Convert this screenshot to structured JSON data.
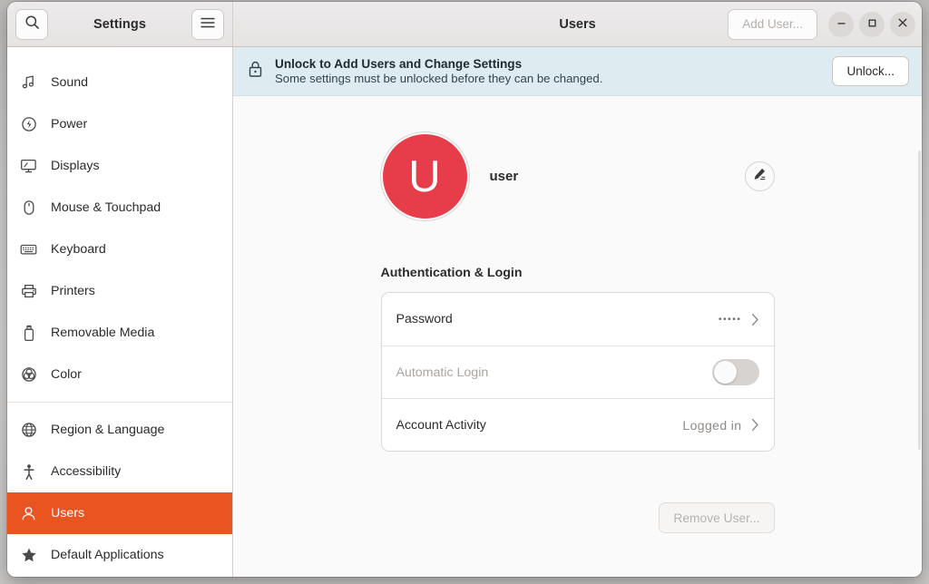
{
  "window": {
    "app_title": "Settings",
    "page_title": "Users"
  },
  "header": {
    "search_icon": "search-icon",
    "menu_icon": "hamburger-menu-icon",
    "add_user_label": "Add User...",
    "minimize_icon": "minimize-icon",
    "maximize_icon": "maximize-icon",
    "close_icon": "close-icon"
  },
  "sidebar": {
    "items": [
      {
        "label": "Sound",
        "icon": "music-note-icon",
        "selected": false,
        "sep_after": false
      },
      {
        "label": "Power",
        "icon": "power-bolt-icon",
        "selected": false,
        "sep_after": false
      },
      {
        "label": "Displays",
        "icon": "monitor-icon",
        "selected": false,
        "sep_after": false
      },
      {
        "label": "Mouse & Touchpad",
        "icon": "mouse-icon",
        "selected": false,
        "sep_after": false
      },
      {
        "label": "Keyboard",
        "icon": "keyboard-icon",
        "selected": false,
        "sep_after": false
      },
      {
        "label": "Printers",
        "icon": "printer-icon",
        "selected": false,
        "sep_after": false
      },
      {
        "label": "Removable Media",
        "icon": "usb-drive-icon",
        "selected": false,
        "sep_after": false
      },
      {
        "label": "Color",
        "icon": "color-wheel-icon",
        "selected": false,
        "sep_after": true
      },
      {
        "label": "Region & Language",
        "icon": "globe-icon",
        "selected": false,
        "sep_after": false
      },
      {
        "label": "Accessibility",
        "icon": "accessibility-icon",
        "selected": false,
        "sep_after": false
      },
      {
        "label": "Users",
        "icon": "user-icon",
        "selected": true,
        "sep_after": false
      },
      {
        "label": "Default Applications",
        "icon": "star-icon",
        "selected": false,
        "sep_after": false
      }
    ]
  },
  "banner": {
    "lock_icon": "lock-icon",
    "title": "Unlock to Add Users and Change Settings",
    "subtitle": "Some settings must be unlocked before they can be changed.",
    "unlock_label": "Unlock..."
  },
  "user": {
    "avatar_initial": "U",
    "name": "user",
    "edit_icon": "pencil-edit-icon"
  },
  "auth": {
    "section_title": "Authentication & Login",
    "rows": [
      {
        "label": "Password",
        "value": "•••••",
        "kind": "dots",
        "dim": false,
        "chevron": true
      },
      {
        "label": "Automatic Login",
        "value": "",
        "kind": "switch",
        "dim": true,
        "chevron": false
      },
      {
        "label": "Account Activity",
        "value": "Logged in",
        "kind": "text",
        "dim": false,
        "chevron": true
      }
    ]
  },
  "footer": {
    "remove_user_label": "Remove User..."
  },
  "colors": {
    "accent": "#e95420",
    "avatar": "#e73d4a",
    "banner_bg": "#deecf1",
    "header_bg": "#eceaea",
    "content_bg": "#fafafa"
  }
}
